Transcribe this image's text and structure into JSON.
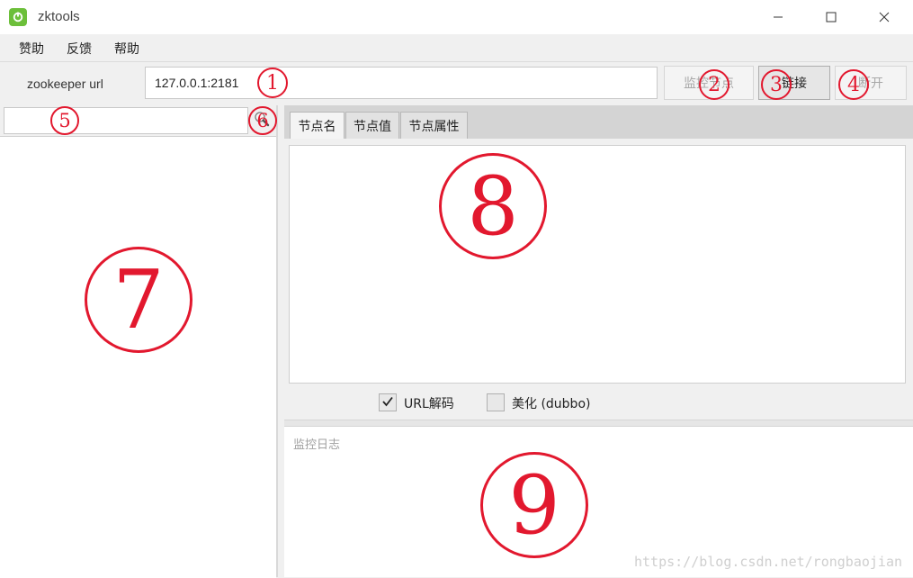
{
  "window": {
    "title": "zktools",
    "controls": {
      "minimize_icon": "minimize-icon",
      "maximize_icon": "maximize-icon",
      "close_icon": "close-icon"
    }
  },
  "menu": {
    "items": [
      {
        "label": "赞助"
      },
      {
        "label": "反馈"
      },
      {
        "label": "帮助"
      }
    ]
  },
  "toolbar": {
    "url_label": "zookeeper url",
    "url_value": "127.0.0.1:2181",
    "buttons": {
      "monitor": "监控节点",
      "connect": "链接",
      "disconnect": "断开"
    }
  },
  "left_panel": {
    "search_value": ""
  },
  "right_panel": {
    "tabs": [
      {
        "label": "节点名"
      },
      {
        "label": "节点值"
      },
      {
        "label": "节点属性"
      }
    ],
    "checkboxes": {
      "url_decode": {
        "label": "URL解码",
        "checked": true
      },
      "beautify": {
        "label": "美化 (dubbo)",
        "checked": false
      }
    },
    "log_placeholder": "监控日志"
  },
  "annotations": [
    "1",
    "2",
    "3",
    "4",
    "5",
    "6",
    "7",
    "8",
    "9"
  ],
  "watermark": "https://blog.csdn.net/rongbaojian",
  "colors": {
    "annotation": "#e2182e",
    "app_icon": "#6cbf3a"
  }
}
